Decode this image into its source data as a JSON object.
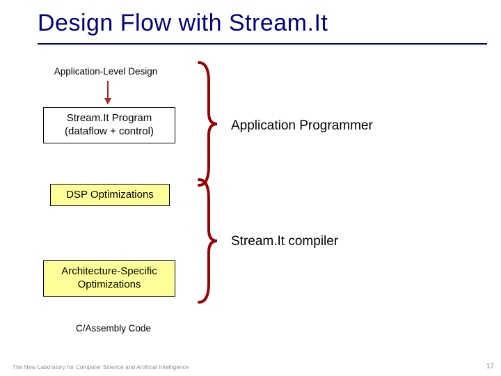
{
  "title": "Design Flow with Stream.It",
  "flow": {
    "app_level_design": "Application-Level Design",
    "streamit_program": "Stream.It Program\n(dataflow + control)",
    "dsp_optimizations": "DSP Optimizations",
    "arch_specific": "Architecture-Specific\nOptimizations",
    "c_assembly": "C/Assembly Code"
  },
  "annotations": {
    "app_programmer": "Application Programmer",
    "streamit_compiler": "Stream.It compiler"
  },
  "footer": "The New Laboratory for Computer Science and Artificial Intelligence",
  "page_number": "17",
  "colors": {
    "title": "#000080",
    "brace": "#990000",
    "arrow": "#b22222",
    "hilite": "#ffff99"
  }
}
